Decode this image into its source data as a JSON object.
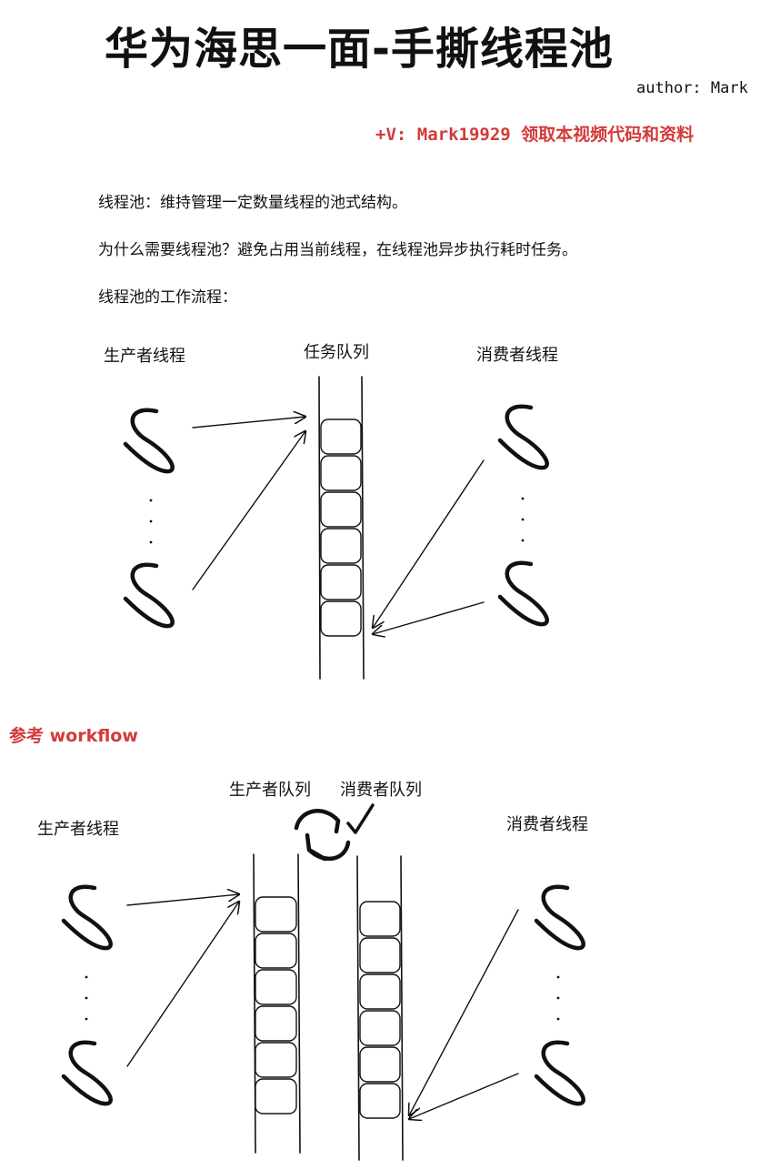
{
  "header": {
    "title": "华为海思一面-手撕线程池",
    "author": "author: Mark",
    "promo": "+V: Mark19929 领取本视频代码和资料"
  },
  "intro": {
    "definition": "线程池：维持管理一定数量线程的池式结构。",
    "why": "为什么需要线程池？避免占用当前线程，在线程池异步执行耗时任务。",
    "workflow": "线程池的工作流程："
  },
  "diagram1": {
    "producer_label": "生产者线程",
    "queue_label": "任务队列",
    "consumer_label": "消费者线程",
    "queue_slots": 6,
    "ellipsis": "·"
  },
  "reference": {
    "label": "参考 workflow"
  },
  "diagram2": {
    "producer_label": "生产者线程",
    "producer_queue_label": "生产者队列",
    "consumer_queue_label": "消费者队列",
    "consumer_label": "消费者线程",
    "producer_queue_slots": 6,
    "consumer_queue_slots": 6,
    "ellipsis": "·"
  }
}
